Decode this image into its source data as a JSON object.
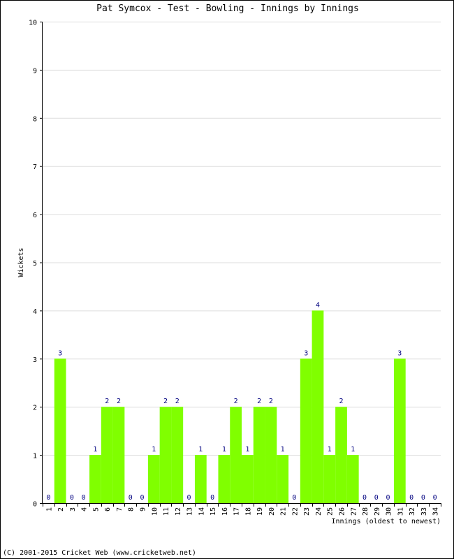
{
  "page": {
    "footer": "(C) 2001-2015 Cricket Web (www.cricketweb.net)"
  },
  "colors": {
    "bar": "#80ff00",
    "label": "#000080",
    "grid": "#dddddd",
    "axis": "#000000"
  },
  "chart_data": {
    "type": "bar",
    "title": "Pat Symcox - Test - Bowling - Innings by Innings",
    "xlabel": "Innings (oldest to newest)",
    "ylabel": "Wickets",
    "ylim": [
      0,
      10
    ],
    "yticks": [
      "0",
      "1",
      "2",
      "3",
      "4",
      "5",
      "6",
      "7",
      "8",
      "9",
      "10"
    ],
    "grid": true,
    "categories": [
      "1",
      "2",
      "3",
      "4",
      "5",
      "6",
      "7",
      "8",
      "9",
      "10",
      "11",
      "12",
      "13",
      "14",
      "15",
      "16",
      "17",
      "18",
      "19",
      "20",
      "21",
      "22",
      "23",
      "24",
      "25",
      "26",
      "27",
      "28",
      "29",
      "30",
      "31",
      "32",
      "33",
      "34"
    ],
    "values": [
      0,
      3,
      0,
      0,
      1,
      2,
      2,
      0,
      0,
      1,
      2,
      2,
      0,
      1,
      0,
      1,
      2,
      1,
      2,
      2,
      1,
      0,
      3,
      4,
      1,
      2,
      1,
      0,
      0,
      0,
      3,
      0,
      0,
      0
    ]
  }
}
